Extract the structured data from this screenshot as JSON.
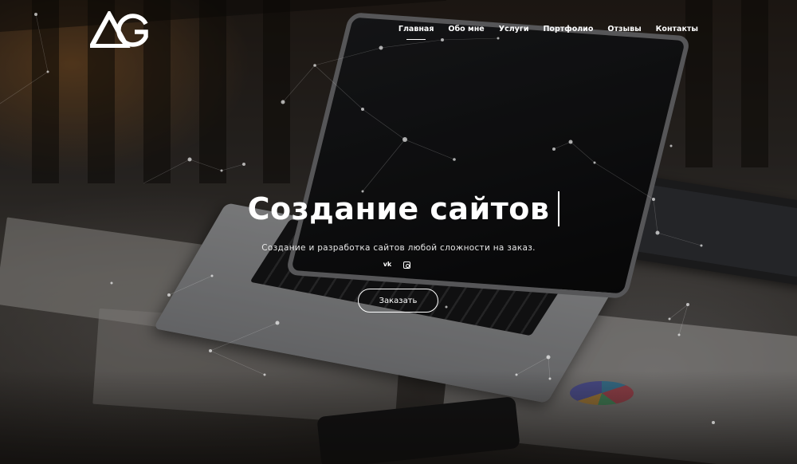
{
  "header": {
    "logo_icon": "ag-logo",
    "nav": [
      {
        "label": "Главная",
        "active": true
      },
      {
        "label": "Обо мне",
        "active": false
      },
      {
        "label": "Услуги",
        "active": false
      },
      {
        "label": "Портфолио",
        "active": false
      },
      {
        "label": "Отзывы",
        "active": false
      },
      {
        "label": "Контакты",
        "active": false
      }
    ]
  },
  "hero": {
    "title": "Создание сайтов",
    "subtitle": "Создание и разработка сайтов любой сложности на заказ.",
    "social": [
      {
        "icon": "vk-icon",
        "label": "vk"
      },
      {
        "icon": "instagram-icon"
      }
    ],
    "cta_label": "Заказать"
  },
  "colors": {
    "text": "#ffffff",
    "overlay": "#000000"
  }
}
